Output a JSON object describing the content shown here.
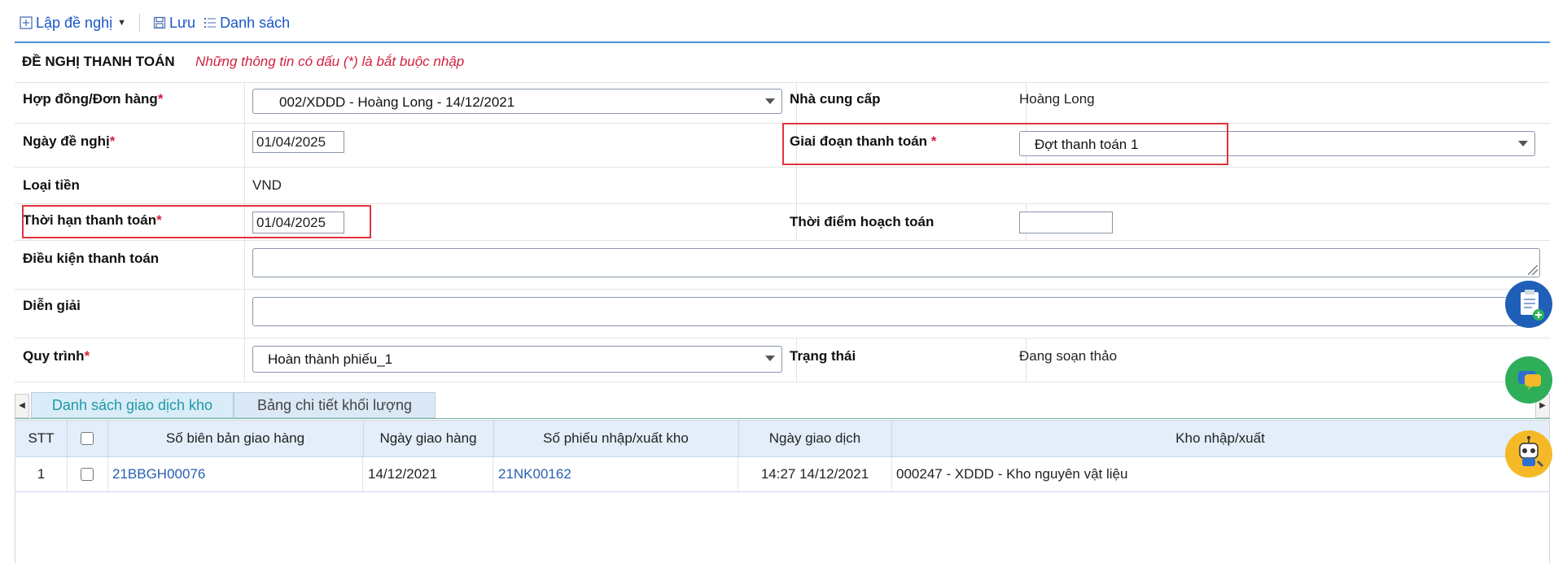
{
  "toolbar": {
    "new_label": "Lập đề nghị",
    "save_label": "Lưu",
    "list_label": "Danh sách"
  },
  "section": {
    "title": "ĐỀ NGHỊ THANH TOÁN",
    "note": "Những thông tin có dấu (*) là bắt buộc nhập"
  },
  "form": {
    "contract_label": "Hợp đồng/Đơn hàng",
    "contract_value": "002/XDDD - Hoàng Long - 14/12/2021",
    "supplier_label": "Nhà cung cấp",
    "supplier_value": "Hoàng Long",
    "request_date_label": "Ngày đề nghị",
    "request_date_value": "01/04/2025",
    "payment_phase_label": "Giai đoạn thanh toán",
    "payment_phase_value": "Đợt thanh toán 1",
    "currency_label": "Loại tiền",
    "currency_value": "VND",
    "payment_deadline_label": "Thời hạn thanh toán",
    "payment_deadline_value": "01/04/2025",
    "accounting_time_label": "Thời điểm hoạch toán",
    "accounting_time_value": "",
    "payment_terms_label": "Điều kiện thanh toán",
    "description_label": "Diễn giải",
    "workflow_label": "Quy trình",
    "workflow_value": "Hoàn thành phiếu_1",
    "status_label": "Trạng thái",
    "status_value": "Đang soạn thảo",
    "required_mark": "*",
    "required_mark_spaced": " *"
  },
  "tabs": [
    {
      "label": "Danh sách giao dịch kho",
      "active": true
    },
    {
      "label": "Bảng chi tiết khối lượng",
      "active": false
    }
  ],
  "table": {
    "headers": {
      "stt": "STT",
      "delivery_note": "Số biên bản giao hàng",
      "delivery_date": "Ngày giao hàng",
      "warehouse_slip": "Số phiếu nhập/xuất kho",
      "transaction_date": "Ngày giao dịch",
      "warehouse": "Kho nhập/xuất"
    },
    "rows": [
      {
        "stt": "1",
        "delivery_note": "21BBGH00076",
        "delivery_date": "14/12/2021",
        "warehouse_slip": "21NK00162",
        "transaction_date": "14:27 14/12/2021",
        "warehouse": "000247 - XDDD - Kho nguyên vật liệu"
      }
    ]
  },
  "colors": {
    "accent": "#1a56c8",
    "required": "#d0213f",
    "highlight": "#e0343e",
    "header_bg": "#e3eefa"
  }
}
